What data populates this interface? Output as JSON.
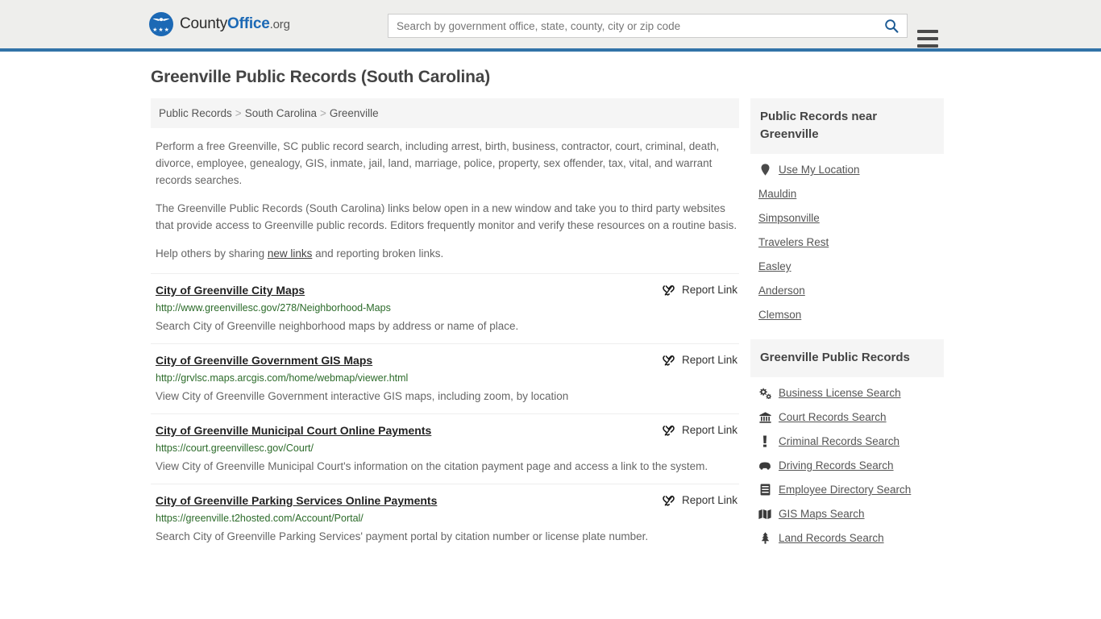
{
  "header": {
    "brand": {
      "part1": "County",
      "part2": "Office",
      "part3": ".org",
      "logo_icon": "eagle-stars-logo",
      "stars": "★★★"
    },
    "search": {
      "placeholder": "Search by government office, state, county, city or zip code",
      "value": "",
      "icon": "search-icon"
    },
    "menu_icon": "hamburger-menu-icon",
    "accent_color": "#3273a8",
    "background_color": "#eeeeec"
  },
  "main": {
    "title": "Greenville Public Records (South Carolina)",
    "breadcrumb": [
      {
        "label": "Public Records"
      },
      {
        "label": "South Carolina"
      },
      {
        "label": "Greenville"
      }
    ],
    "breadcrumb_separator": ">",
    "intro": [
      "Perform a free Greenville, SC public record search, including arrest, birth, business, contractor, court, criminal, death, divorce, employee, genealogy, GIS, inmate, jail, land, marriage, police, property, sex offender, tax, vital, and warrant records searches.",
      "The Greenville Public Records (South Carolina) links below open in a new window and take you to third party websites that provide access to Greenville public records. Editors frequently monitor and verify these resources on a routine basis."
    ],
    "help_prefix": "Help others by sharing ",
    "help_link": "new links",
    "help_suffix": " and reporting broken links.",
    "report_link_label": "Report Link",
    "report_link_icon": "broken-chain-icon",
    "results": [
      {
        "title": "City of Greenville City Maps",
        "url": "http://www.greenvillesc.gov/278/Neighborhood-Maps",
        "description": "Search City of Greenville neighborhood maps by address or name of place."
      },
      {
        "title": "City of Greenville Government GIS Maps",
        "url": "http://grvlsc.maps.arcgis.com/home/webmap/viewer.html",
        "description": "View City of Greenville Government interactive GIS maps, including zoom, by location"
      },
      {
        "title": "City of Greenville Municipal Court Online Payments",
        "url": "https://court.greenvillesc.gov/Court/",
        "description": "View City of Greenville Municipal Court's information on the citation payment page and access a link to the system."
      },
      {
        "title": "City of Greenville Parking Services Online Payments",
        "url": "https://greenville.t2hosted.com/Account/Portal/",
        "description": "Search City of Greenville Parking Services' payment portal by citation number or license plate number."
      }
    ]
  },
  "sidebar": {
    "nearby": {
      "heading": "Public Records near Greenville",
      "items": [
        {
          "label": "Use My Location",
          "icon": "map-pin-icon"
        },
        {
          "label": "Mauldin",
          "icon": ""
        },
        {
          "label": "Simpsonville",
          "icon": ""
        },
        {
          "label": "Travelers Rest",
          "icon": ""
        },
        {
          "label": "Easley",
          "icon": ""
        },
        {
          "label": "Anderson",
          "icon": ""
        },
        {
          "label": "Clemson",
          "icon": ""
        }
      ]
    },
    "records": {
      "heading": "Greenville Public Records",
      "items": [
        {
          "label": "Business License Search",
          "icon": "cogs-icon"
        },
        {
          "label": "Court Records Search",
          "icon": "bank-icon"
        },
        {
          "label": "Criminal Records Search",
          "icon": "exclamation-icon"
        },
        {
          "label": "Driving Records Search",
          "icon": "car-icon"
        },
        {
          "label": "Employee Directory Search",
          "icon": "id-card-icon"
        },
        {
          "label": "GIS Maps Search",
          "icon": "map-icon"
        },
        {
          "label": "Land Records Search",
          "icon": "tree-icon"
        }
      ]
    }
  }
}
